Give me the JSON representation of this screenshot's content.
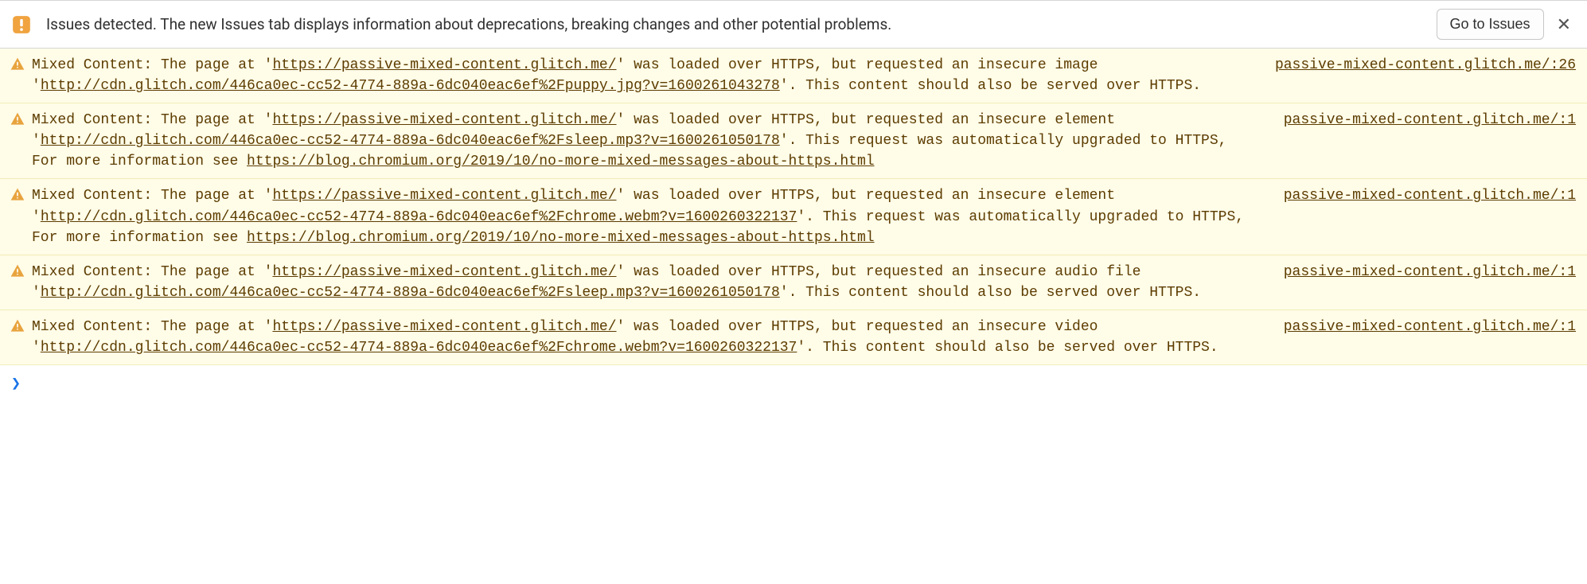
{
  "banner": {
    "text": "Issues detected. The new Issues tab displays information about deprecations, breaking changes and other potential problems.",
    "button": "Go to Issues",
    "close": "✕"
  },
  "messages": [
    {
      "parts": [
        {
          "t": "text",
          "v": "Mixed Content: The page at '"
        },
        {
          "t": "link",
          "v": "https://passive-mixed-content.glitch.me/"
        },
        {
          "t": "text",
          "v": "' was loaded over HTTPS, but requested an insecure image '"
        },
        {
          "t": "link",
          "v": "http://cdn.glitch.com/446ca0ec-cc52-4774-889a-6dc040eac6ef%2Fpuppy.jpg?v=1600261043278"
        },
        {
          "t": "text",
          "v": "'. This content should also be served over HTTPS."
        }
      ],
      "source": "passive-mixed-content.glitch.me/:26"
    },
    {
      "parts": [
        {
          "t": "text",
          "v": "Mixed Content: The page at '"
        },
        {
          "t": "link",
          "v": "https://passive-mixed-content.glitch.me/"
        },
        {
          "t": "text",
          "v": "' was loaded over HTTPS, but requested an insecure element '"
        },
        {
          "t": "link",
          "v": "http://cdn.glitch.com/446ca0ec-cc52-4774-889a-6dc040eac6ef%2Fsleep.mp3?v=1600261050178"
        },
        {
          "t": "text",
          "v": "'. This request was automatically upgraded to HTTPS, For more information see "
        },
        {
          "t": "link",
          "v": "https://blog.chromium.org/2019/10/no-more-mixed-messages-about-https.html"
        }
      ],
      "source": "passive-mixed-content.glitch.me/:1"
    },
    {
      "parts": [
        {
          "t": "text",
          "v": "Mixed Content: The page at '"
        },
        {
          "t": "link",
          "v": "https://passive-mixed-content.glitch.me/"
        },
        {
          "t": "text",
          "v": "' was loaded over HTTPS, but requested an insecure element '"
        },
        {
          "t": "link",
          "v": "http://cdn.glitch.com/446ca0ec-cc52-4774-889a-6dc040eac6ef%2Fchrome.webm?v=1600260322137"
        },
        {
          "t": "text",
          "v": "'. This request was automatically upgraded to HTTPS, For more information see "
        },
        {
          "t": "link",
          "v": "https://blog.chromium.org/2019/10/no-more-mixed-messages-about-https.html"
        }
      ],
      "source": "passive-mixed-content.glitch.me/:1"
    },
    {
      "parts": [
        {
          "t": "text",
          "v": "Mixed Content: The page at '"
        },
        {
          "t": "link",
          "v": "https://passive-mixed-content.glitch.me/"
        },
        {
          "t": "text",
          "v": "' was loaded over HTTPS, but requested an insecure audio file '"
        },
        {
          "t": "link",
          "v": "http://cdn.glitch.com/446ca0ec-cc52-4774-889a-6dc040eac6ef%2Fsleep.mp3?v=1600261050178"
        },
        {
          "t": "text",
          "v": "'. This content should also be served over HTTPS."
        }
      ],
      "source": "passive-mixed-content.glitch.me/:1"
    },
    {
      "parts": [
        {
          "t": "text",
          "v": "Mixed Content: The page at '"
        },
        {
          "t": "link",
          "v": "https://passive-mixed-content.glitch.me/"
        },
        {
          "t": "text",
          "v": "' was loaded over HTTPS, but requested an insecure video '"
        },
        {
          "t": "link",
          "v": "http://cdn.glitch.com/446ca0ec-cc52-4774-889a-6dc040eac6ef%2Fchrome.webm?v=1600260322137"
        },
        {
          "t": "text",
          "v": "'. This content should also be served over HTTPS."
        }
      ],
      "source": "passive-mixed-content.glitch.me/:1"
    }
  ],
  "prompt": "❯"
}
